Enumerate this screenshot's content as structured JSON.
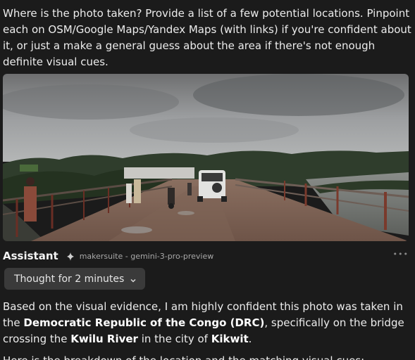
{
  "user_message": {
    "text": "Where is the photo taken? Provide a list of a few potential locations. Pinpoint each on OSM/Google Maps/Yandex Maps (with links) if you're confident about it, or just a make a general guess about the area if there's not enough definite visual cues."
  },
  "photo": {
    "icon": "photo-of-bridge"
  },
  "assistant": {
    "name": "Assistant",
    "model": "makersuite - gemini-3-pro-preview",
    "more": "•••",
    "thought_label": "Thought for 2 minutes"
  },
  "answer": {
    "p1_a": "Based on the visual evidence, I am highly confident this photo was taken in the ",
    "p1_b": "Democratic Republic of the Congo (DRC)",
    "p1_c": ", specifically on the bridge crossing the ",
    "p1_d": "Kwilu River",
    "p1_e": " in the city of ",
    "p1_f": "Kikwit",
    "p1_g": ".",
    "p2_partial": "Here is the breakdown of the location and the matching visual cues:"
  }
}
